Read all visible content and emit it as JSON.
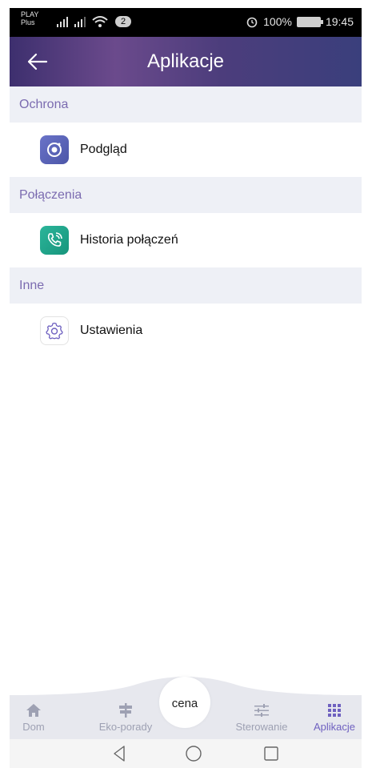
{
  "status_bar": {
    "carrier_line1": "PLAY",
    "carrier_line2": "Plus",
    "notification_count": "2",
    "battery": "100%",
    "time": "19:45"
  },
  "app_bar": {
    "title": "Aplikacje"
  },
  "sections": [
    {
      "header": "Ochrona",
      "items": [
        {
          "label": "Podgląd",
          "icon": "camera-icon"
        }
      ]
    },
    {
      "header": "Połączenia",
      "items": [
        {
          "label": "Historia połączeń",
          "icon": "phone-call-icon"
        }
      ]
    },
    {
      "header": "Inne",
      "items": [
        {
          "label": "Ustawienia",
          "icon": "gear-icon"
        }
      ]
    }
  ],
  "bottom_nav": {
    "items": [
      {
        "label": "Dom",
        "icon": "home-icon"
      },
      {
        "label": "Eko-porady",
        "icon": "signpost-icon"
      },
      {
        "label": "Sterowanie",
        "icon": "sliders-icon"
      },
      {
        "label": "Aplikacje",
        "icon": "grid-icon",
        "active": true
      }
    ],
    "center_label": "cena"
  },
  "colors": {
    "accent": "#6f61c0",
    "section_bg": "#eef0f6",
    "inactive_nav": "#9ea1b3"
  }
}
